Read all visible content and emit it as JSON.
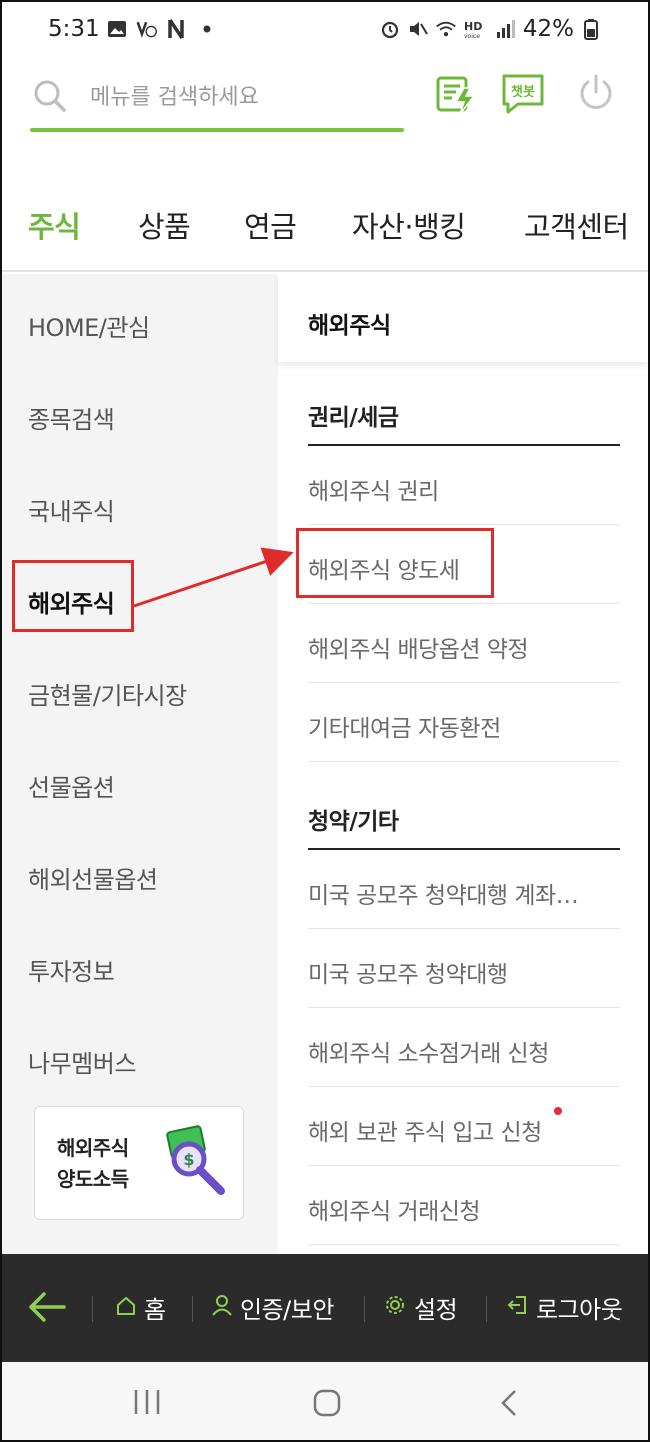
{
  "status_bar": {
    "time": "5:31",
    "battery": "42%"
  },
  "search": {
    "placeholder": "메뉴를 검색하세요"
  },
  "header_icons": {
    "chatbot_label": "챗봇"
  },
  "top_nav": {
    "items": [
      "주식",
      "상품",
      "연금",
      "자산·뱅킹",
      "고객센터"
    ],
    "active": "주식"
  },
  "sidebar": {
    "items": [
      "HOME/관심",
      "종목검색",
      "국내주식",
      "해외주식",
      "금현물/기타시장",
      "선물옵션",
      "해외선물옵션",
      "투자정보",
      "나무멤버스"
    ],
    "active": "해외주식",
    "promo": {
      "line1": "해외주식",
      "line2": "양도소득"
    }
  },
  "panel": {
    "title": "해외주식",
    "sections": [
      {
        "title": "권리/세금",
        "items": [
          "해외주식 권리",
          "해외주식 양도세",
          "해외주식 배당옵션 약정",
          "기타대여금 자동환전"
        ]
      },
      {
        "title": "청약/기타",
        "items": [
          "미국 공모주 청약대행 계좌…",
          "미국 공모주 청약대행",
          "해외주식 소수점거래 신청",
          "해외 보관 주식 입고 신청",
          "해외주식 거래신청"
        ]
      }
    ]
  },
  "bottom_bar": {
    "home": "홈",
    "auth": "인증/보안",
    "settings": "설정",
    "logout": "로그아웃"
  },
  "colors": {
    "accent_green": "#6fb73a",
    "highlight_red": "#e02b2b",
    "bottom_bar_bg": "#2b2b2b"
  }
}
